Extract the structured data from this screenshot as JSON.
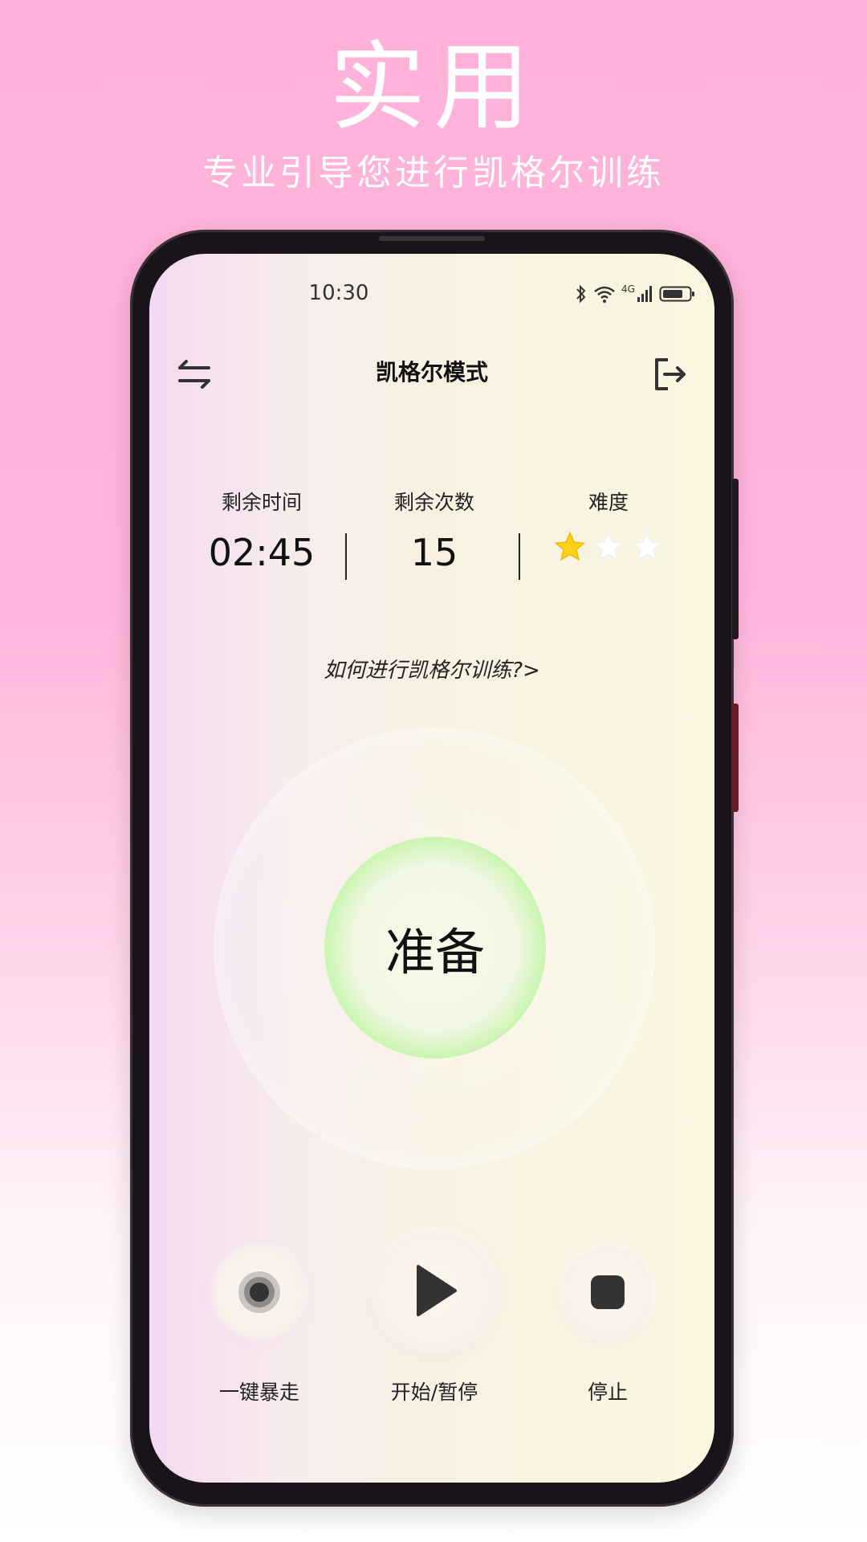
{
  "promo": {
    "title": "实用",
    "subtitle": "专业引导您进行凯格尔训练"
  },
  "status_bar": {
    "time": "10:30",
    "icons": [
      "bluetooth-icon",
      "wifi-icon",
      "signal-4g-icon",
      "battery-icon"
    ],
    "signal_label": "4G"
  },
  "header": {
    "title": "凯格尔模式",
    "left_icon": "swap-icon",
    "right_icon": "logout-icon"
  },
  "stats": {
    "time_label": "剩余时间",
    "time_value": "02:45",
    "count_label": "剩余次数",
    "count_value": "15",
    "difficulty_label": "难度",
    "difficulty_stars": 1,
    "difficulty_max": 3
  },
  "help_link": "如何进行凯格尔训练?>",
  "main_button": {
    "label": "准备"
  },
  "controls": {
    "rampage_label": "一键暴走",
    "play_pause_label": "开始/暂停",
    "stop_label": "停止"
  },
  "colors": {
    "background_pink": "#ffb1d9",
    "ring_green": "#7ef074",
    "star_active": "#ffd21a",
    "star_inactive": "#ffffff"
  }
}
